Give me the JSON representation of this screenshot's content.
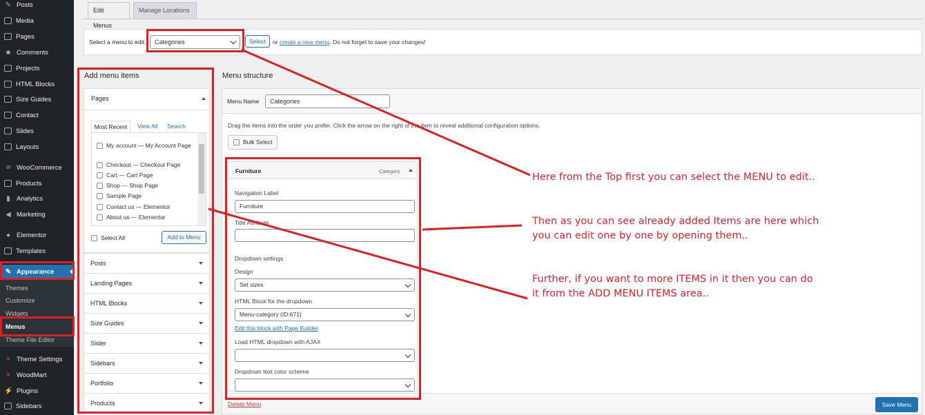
{
  "sidebar": {
    "items": [
      {
        "label": "Posts",
        "icon": "pin-icon"
      },
      {
        "label": "Media",
        "icon": "media-icon"
      },
      {
        "label": "Pages",
        "icon": "pages-icon"
      },
      {
        "label": "Comments",
        "icon": "comments-icon"
      },
      {
        "label": "Projects",
        "icon": "projects-icon"
      },
      {
        "label": "HTML Blocks",
        "icon": "blocks-icon"
      },
      {
        "label": "Size Guides",
        "icon": "size-guides-icon"
      },
      {
        "label": "Contact",
        "icon": "mail-icon"
      },
      {
        "label": "Slides",
        "icon": "slides-icon"
      },
      {
        "label": "Layouts",
        "icon": "layouts-icon"
      },
      {
        "label": "WooCommerce",
        "icon": "woocommerce-icon"
      },
      {
        "label": "Products",
        "icon": "products-icon"
      },
      {
        "label": "Analytics",
        "icon": "analytics-icon"
      },
      {
        "label": "Marketing",
        "icon": "marketing-icon"
      },
      {
        "label": "Elementor",
        "icon": "elementor-icon"
      },
      {
        "label": "Templates",
        "icon": "templates-icon"
      },
      {
        "label": "Appearance",
        "icon": "brush-icon"
      },
      {
        "label": "Theme Settings",
        "icon": "theme-settings-icon"
      },
      {
        "label": "WoodMart",
        "icon": "woodmart-icon"
      },
      {
        "label": "Plugins",
        "icon": "plugins-icon"
      },
      {
        "label": "Sidebars",
        "icon": "sidebars-icon"
      }
    ],
    "submenu": [
      "Themes",
      "Customize",
      "Widgets",
      "Menus",
      "Theme File Editor"
    ]
  },
  "tabs": {
    "edit": "Edit Menus",
    "locations": "Manage Locations"
  },
  "select_menu": {
    "label": "Select a menu to edit:",
    "value": "Categories",
    "button": "Select",
    "or": "or",
    "create_link": "create a new menu",
    "reminder": ". Do not forget to save your changes!"
  },
  "add_items": {
    "title": "Add menu items",
    "pages_title": "Pages",
    "subtabs": [
      "Most Recent",
      "View All",
      "Search"
    ],
    "page_list": [
      "My account — My Account Page",
      "Checkout — Checkout Page",
      "Cart — Cart Page",
      "Shop — Shop Page",
      "Sample Page",
      "Contact us — Elementor",
      "About us — Elementor"
    ],
    "select_all": "Select All",
    "add_button": "Add to Menu",
    "sections": [
      "Posts",
      "Landing Pages",
      "HTML Blocks",
      "Size Guides",
      "Slider",
      "Sidebars",
      "Portfolio",
      "Products"
    ]
  },
  "structure": {
    "title": "Menu structure",
    "name_label": "Menu Name",
    "name_value": "Categories",
    "instructions": "Drag the items into the order you prefer. Click the arrow on the right of the item to reveal additional configuration options.",
    "bulk_select": "Bulk Select",
    "item": {
      "title": "Furniture",
      "type": "Category",
      "nav_label": "Navigation Label",
      "nav_value": "Furniture",
      "title_attr": "Title Attribute",
      "dropdown_heading": "Dropdown settings",
      "design_label": "Design",
      "design_value": "Set sizes",
      "html_block_label": "HTML Block for the dropdown",
      "html_block_value": "Menu-category (ID:671)",
      "edit_link": "Edit this block with Page Builder",
      "ajax_label": "Load HTML dropdown with AJAX",
      "ajax_value": "",
      "color_label": "Dropdown text color scheme",
      "color_value": ""
    },
    "delete_link": "Delete Menu",
    "save_button": "Save Menu"
  },
  "annotations": {
    "note1": "Here from the Top first you can select the MENU to edit..",
    "note2_line1": "Then as you can see already added Items are here which",
    "note2_line2": "you can edit one by one by opening them..",
    "note3_line1": "Further, if you want to more ITEMS in it then you can do",
    "note3_line2": "it from the ADD MENU ITEMS area.."
  },
  "colors": {
    "annotation": "#e02020",
    "accent": "#2271b1",
    "sidebar": "#1d2327"
  }
}
